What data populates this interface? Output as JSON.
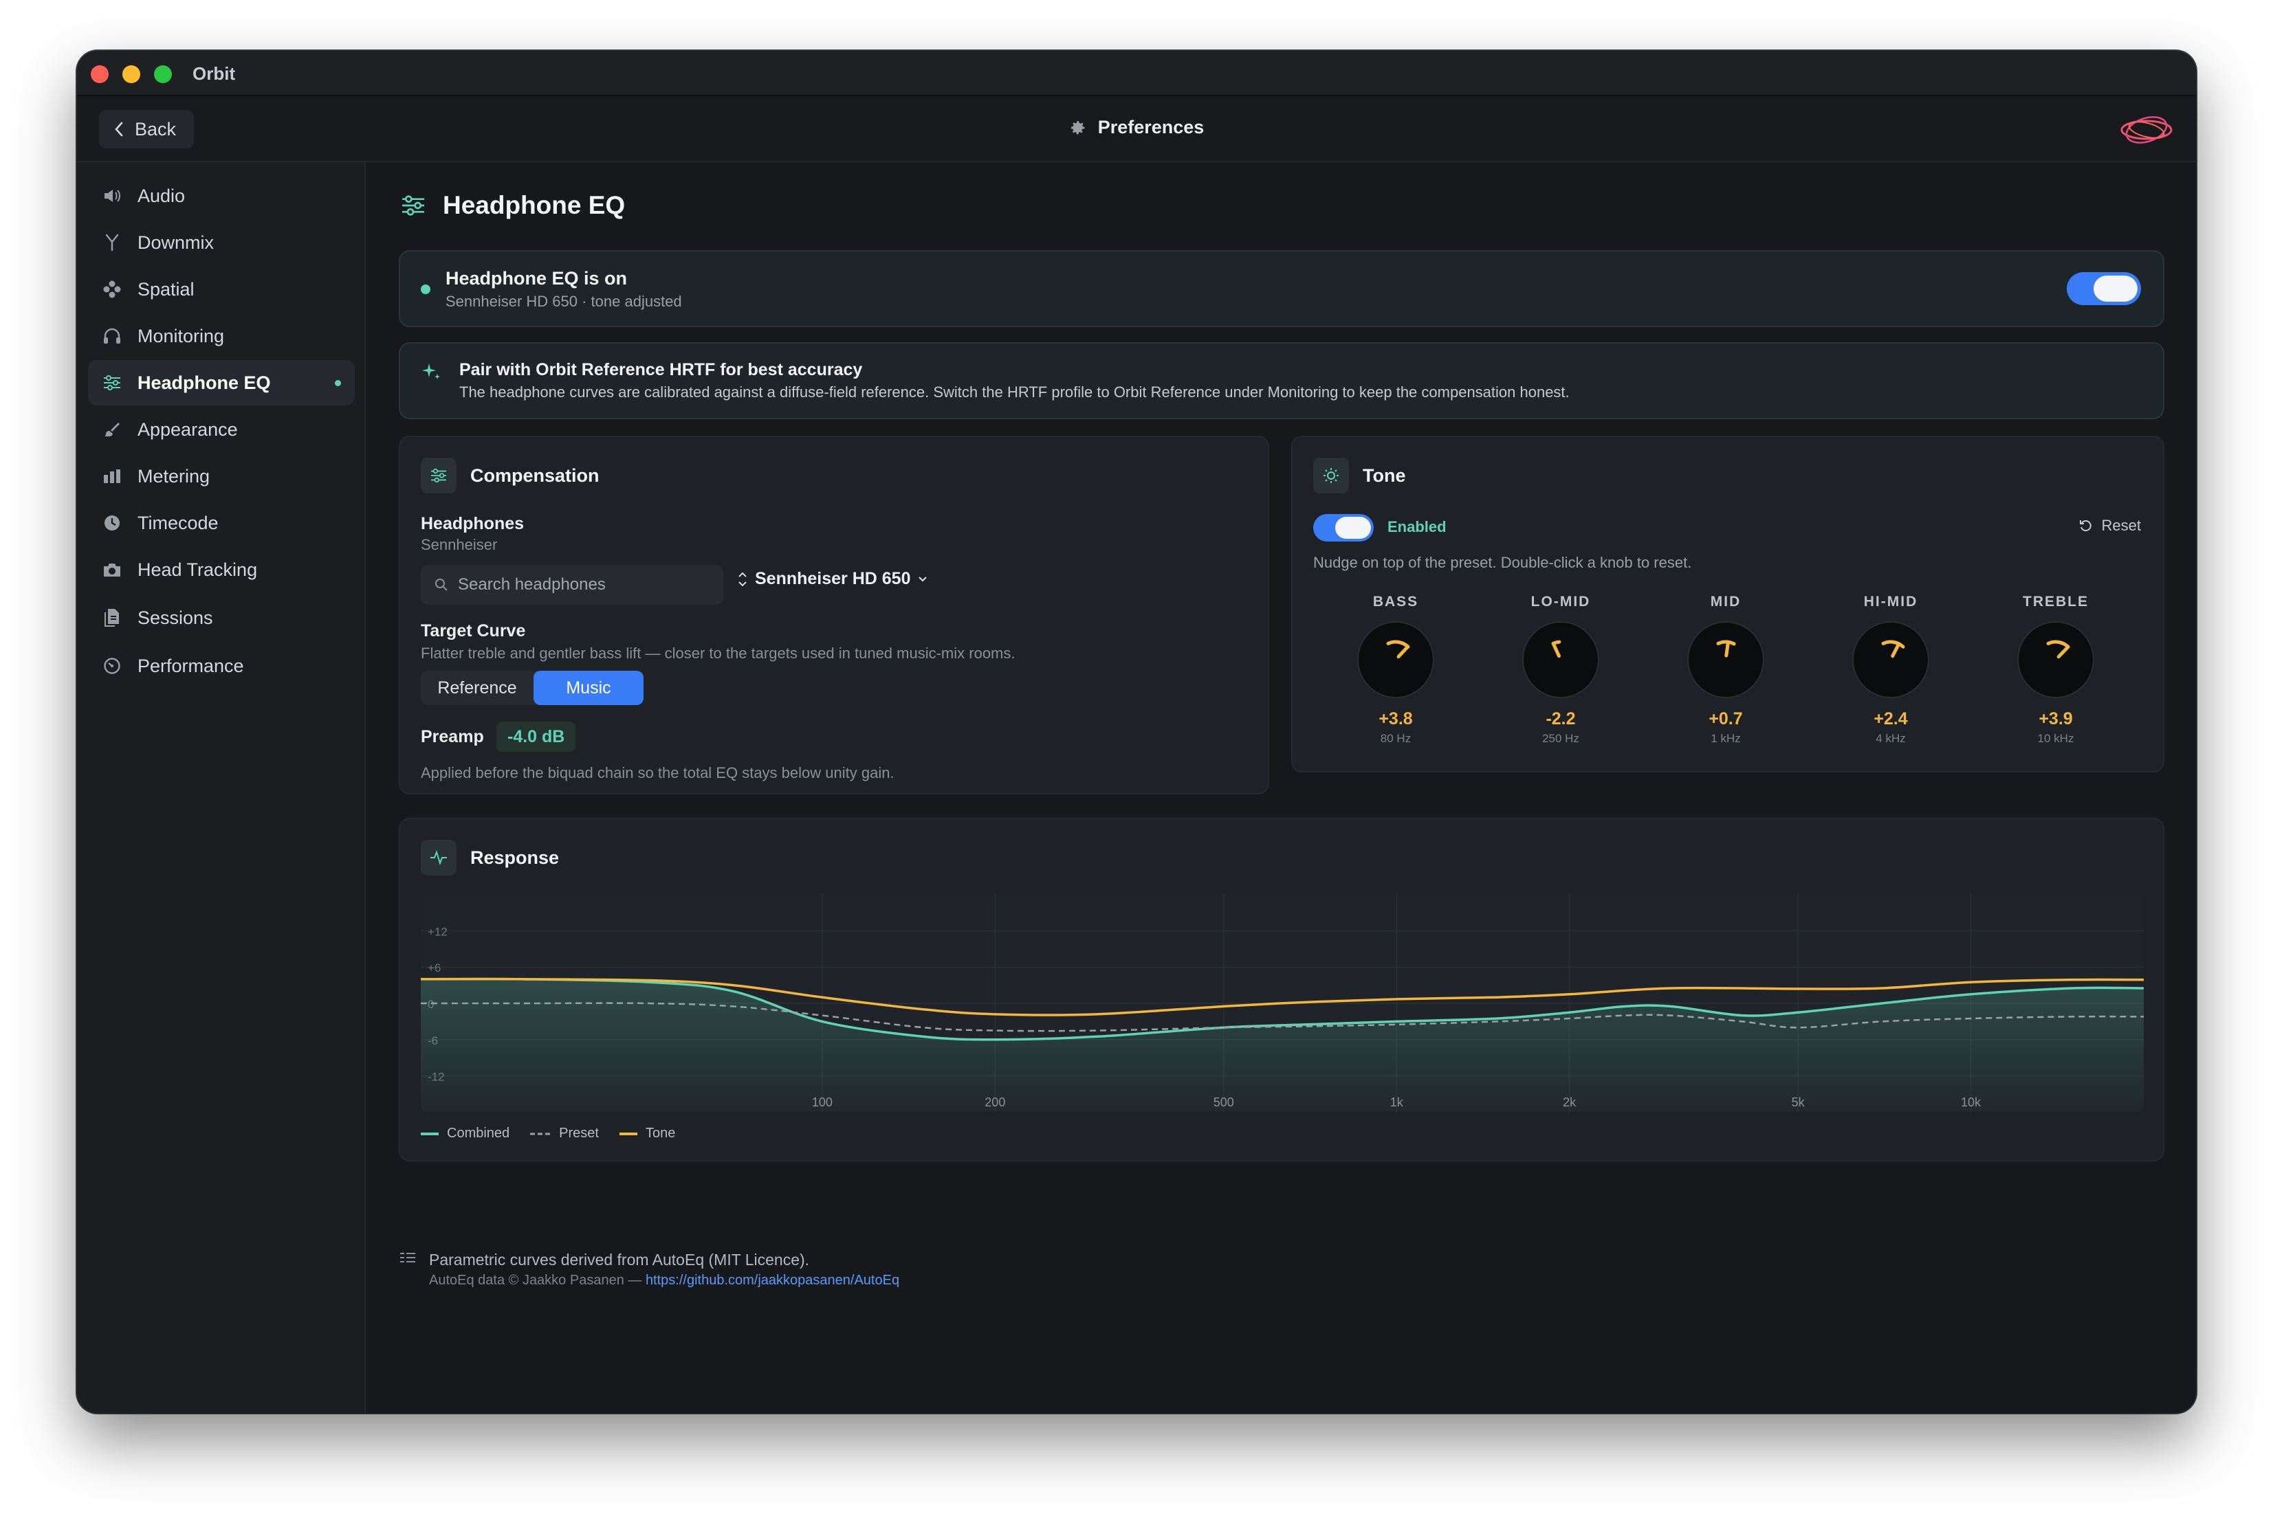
{
  "window": {
    "app_title": "Orbit"
  },
  "toolbar": {
    "back_label": "Back",
    "title": "Preferences",
    "logo": "orbit-logo"
  },
  "sidebar": {
    "items": [
      {
        "label": "Audio",
        "icon": "speaker-icon"
      },
      {
        "label": "Downmix",
        "icon": "downmix-icon"
      },
      {
        "label": "Spatial",
        "icon": "spatial-icon"
      },
      {
        "label": "Monitoring",
        "icon": "headphones-icon"
      },
      {
        "label": "Headphone EQ",
        "icon": "sliders-icon",
        "active": true
      },
      {
        "label": "Appearance",
        "icon": "brush-icon"
      },
      {
        "label": "Metering",
        "icon": "bars-icon"
      },
      {
        "label": "Timecode",
        "icon": "clock-icon"
      },
      {
        "label": "Head Tracking",
        "icon": "camera-icon"
      },
      {
        "label": "Sessions",
        "icon": "document-icon"
      },
      {
        "label": "Performance",
        "icon": "gauge-icon"
      }
    ]
  },
  "page": {
    "title": "Headphone EQ"
  },
  "status": {
    "title": "Headphone EQ is on",
    "subtitle": "Sennheiser HD 650 · tone adjusted",
    "enabled": true
  },
  "tip": {
    "title": "Pair with Orbit Reference HRTF for best accuracy",
    "body": "The headphone curves are calibrated against a diffuse-field reference. Switch the HRTF profile to Orbit Reference under Monitoring to keep the compensation honest."
  },
  "compensation": {
    "title": "Compensation",
    "headphones_label": "Headphones",
    "headphones_brand": "Sennheiser",
    "search_placeholder": "Search headphones",
    "selected_model": "Sennheiser HD 650",
    "target_label": "Target Curve",
    "target_desc": "Flatter treble and gentler bass lift — closer to the targets used in tuned music-mix rooms.",
    "target_options": [
      "Reference",
      "Music"
    ],
    "target_selected": "Music",
    "preamp_label": "Preamp",
    "preamp_value": "-4.0 dB",
    "preamp_desc": "Applied before the biquad chain so the total EQ stays below unity gain."
  },
  "tone": {
    "title": "Tone",
    "enabled_label": "Enabled",
    "enabled": true,
    "reset_label": "Reset",
    "hint": "Nudge on top of the preset. Double-click a knob to reset.",
    "knobs": [
      {
        "name": "BASS",
        "value": "+3.8",
        "freq": "80 Hz",
        "gain": 3.8
      },
      {
        "name": "LO-MID",
        "value": "-2.2",
        "freq": "250 Hz",
        "gain": -2.2
      },
      {
        "name": "MID",
        "value": "+0.7",
        "freq": "1 kHz",
        "gain": 0.7
      },
      {
        "name": "HI-MID",
        "value": "+2.4",
        "freq": "4 kHz",
        "gain": 2.4
      },
      {
        "name": "TREBLE",
        "value": "+3.9",
        "freq": "10 kHz",
        "gain": 3.9
      }
    ],
    "accent_color": "#f3b63f"
  },
  "response": {
    "title": "Response",
    "legend": [
      "Combined",
      "Preset",
      "Tone"
    ]
  },
  "chart_data": {
    "type": "line",
    "x_scale": "log",
    "xlim": [
      20,
      20000
    ],
    "ylim": [
      -15,
      15
    ],
    "y_ticks": [
      "+12",
      "+6",
      "0",
      "-6",
      "-12"
    ],
    "x_ticks": [
      {
        "value": 100,
        "label": "100"
      },
      {
        "value": 200,
        "label": "200"
      },
      {
        "value": 500,
        "label": "500"
      },
      {
        "value": 1000,
        "label": "1k"
      },
      {
        "value": 2000,
        "label": "2k"
      },
      {
        "value": 5000,
        "label": "5k"
      },
      {
        "value": 10000,
        "label": "10k"
      }
    ],
    "grid": true,
    "legend_position": "bottom-left",
    "series": [
      {
        "name": "Combined",
        "color": "#5fd4b5",
        "style": "solid",
        "x": [
          20,
          30,
          50,
          70,
          100,
          150,
          200,
          300,
          500,
          700,
          1000,
          1500,
          2000,
          2500,
          3000,
          4000,
          5000,
          7000,
          10000,
          15000,
          20000
        ],
        "y": [
          4.0,
          4.0,
          3.5,
          2.0,
          -3.0,
          -5.5,
          -6.0,
          -5.5,
          -4.0,
          -3.5,
          -3.0,
          -2.5,
          -1.5,
          -0.5,
          -0.5,
          -2.0,
          -1.5,
          0.0,
          1.5,
          2.5,
          2.5
        ]
      },
      {
        "name": "Preset",
        "color": "#9aa0a6",
        "style": "dashed",
        "x": [
          20,
          30,
          50,
          70,
          100,
          150,
          200,
          300,
          500,
          700,
          1000,
          1500,
          2000,
          2500,
          3000,
          4000,
          5000,
          7000,
          10000,
          15000,
          20000
        ],
        "y": [
          0.0,
          0.0,
          0.0,
          -0.5,
          -2.0,
          -4.0,
          -4.5,
          -4.5,
          -4.0,
          -3.8,
          -3.5,
          -3.0,
          -2.5,
          -2.0,
          -2.0,
          -3.0,
          -4.0,
          -3.0,
          -2.5,
          -2.2,
          -2.2
        ]
      },
      {
        "name": "Tone",
        "color": "#f3b63f",
        "style": "solid",
        "x": [
          20,
          30,
          50,
          70,
          100,
          150,
          200,
          300,
          500,
          700,
          1000,
          1500,
          2000,
          3000,
          5000,
          7000,
          10000,
          15000,
          20000
        ],
        "y": [
          4.0,
          4.0,
          3.8,
          3.0,
          1.0,
          -1.0,
          -1.8,
          -1.8,
          -0.5,
          0.2,
          0.7,
          1.0,
          1.5,
          2.5,
          2.4,
          2.5,
          3.5,
          3.9,
          3.9
        ]
      }
    ]
  },
  "footer": {
    "credit": "Parametric curves derived from AutoEq (MIT Licence).",
    "attribution": "AutoEq data © Jaakko Pasanen — ",
    "link": "https://github.com/jaakkopasanen/AutoEq"
  }
}
